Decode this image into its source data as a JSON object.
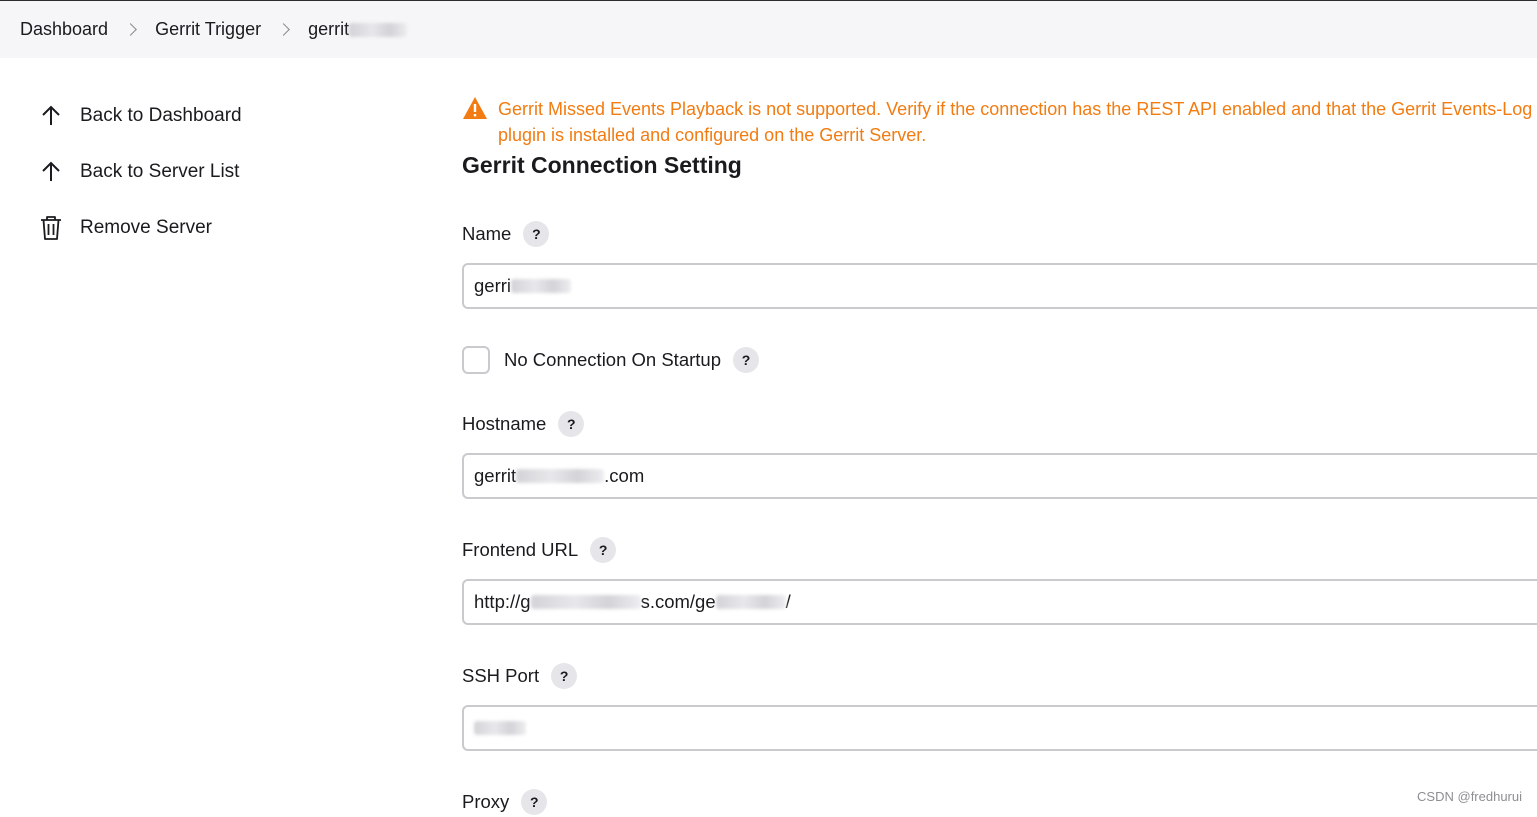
{
  "breadcrumb": {
    "items": [
      {
        "label": "Dashboard"
      },
      {
        "label": "Gerrit Trigger"
      },
      {
        "label": "gerrit"
      }
    ]
  },
  "sidebar": {
    "items": [
      {
        "label": "Back to Dashboard",
        "icon": "arrow-up-icon"
      },
      {
        "label": "Back to Server List",
        "icon": "arrow-up-icon"
      },
      {
        "label": "Remove Server",
        "icon": "trash-icon"
      }
    ]
  },
  "warning": {
    "text": "Gerrit Missed Events Playback is not supported. Verify if the connection has the REST API enabled and that the Gerrit Events-Log plugin is installed and configured on the Gerrit Server.",
    "color": "#f27c12"
  },
  "form": {
    "title": "Gerrit Connection Setting",
    "name": {
      "label": "Name",
      "value": "gerri"
    },
    "no_connection": {
      "label": "No Connection On Startup",
      "checked": false
    },
    "hostname": {
      "label": "Hostname",
      "value_prefix": "gerrit",
      "value_suffix": ".com"
    },
    "frontend_url": {
      "label": "Frontend URL",
      "value_prefix": "http://g",
      "value_mid": "s.com/ge",
      "value_suffix": "/"
    },
    "ssh_port": {
      "label": "SSH Port",
      "value": ""
    },
    "proxy": {
      "label": "Proxy"
    }
  },
  "help_symbol": "?",
  "watermark": "CSDN @fredhurui"
}
